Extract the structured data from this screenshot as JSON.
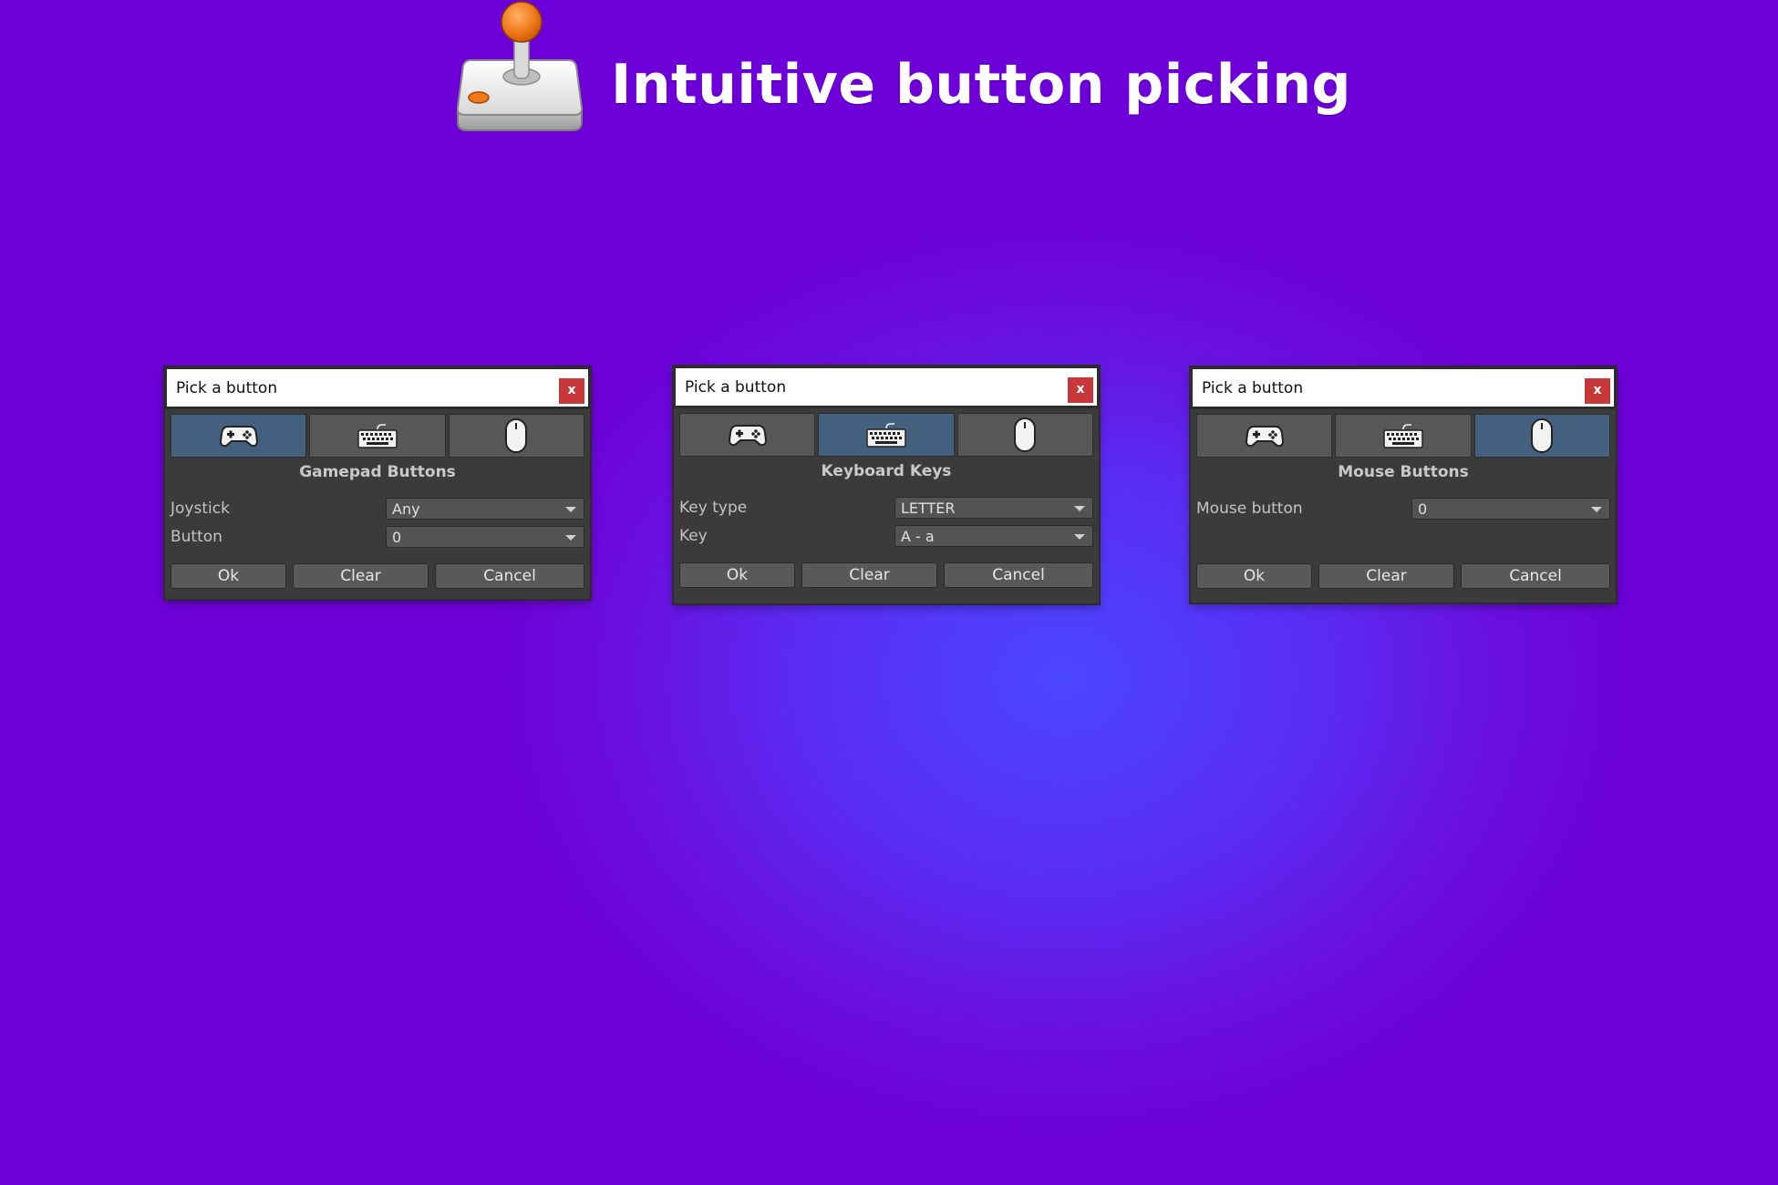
{
  "header": {
    "title": "Intuitive button picking",
    "logo_icon": "joystick-icon"
  },
  "colors": {
    "background": "#6d00d8",
    "background_glow": "#4b46ff",
    "dialog_body": "#3b3b3b",
    "tab_active": "#43607f",
    "tab_inactive": "#575757",
    "close_button": "#c8383a"
  },
  "dialogs": [
    {
      "title": "Pick a button",
      "close_label": "x",
      "active_tab": "gamepad",
      "tabs": [
        "gamepad-icon",
        "keyboard-icon",
        "mouse-icon"
      ],
      "section_title": "Gamepad Buttons",
      "fields": [
        {
          "label": "Joystick",
          "value": "Any"
        },
        {
          "label": "Button",
          "value": "0"
        }
      ],
      "buttons": {
        "ok": "Ok",
        "clear": "Clear",
        "cancel": "Cancel"
      }
    },
    {
      "title": "Pick a button",
      "close_label": "x",
      "active_tab": "keyboard",
      "tabs": [
        "gamepad-icon",
        "keyboard-icon",
        "mouse-icon"
      ],
      "section_title": "Keyboard Keys",
      "fields": [
        {
          "label": "Key type",
          "value": "LETTER"
        },
        {
          "label": "Key",
          "value": "A - a"
        }
      ],
      "buttons": {
        "ok": "Ok",
        "clear": "Clear",
        "cancel": "Cancel"
      }
    },
    {
      "title": "Pick a button",
      "close_label": "x",
      "active_tab": "mouse",
      "tabs": [
        "gamepad-icon",
        "keyboard-icon",
        "mouse-icon"
      ],
      "section_title": "Mouse Buttons",
      "fields": [
        {
          "label": "Mouse button",
          "value": "0"
        }
      ],
      "buttons": {
        "ok": "Ok",
        "clear": "Clear",
        "cancel": "Cancel"
      }
    }
  ]
}
